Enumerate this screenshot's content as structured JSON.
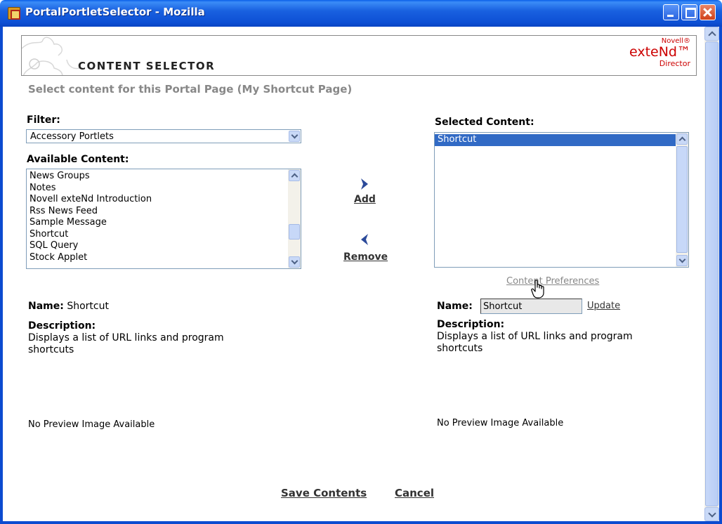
{
  "window": {
    "title": "PortalPortletSelector - Mozilla",
    "icon": "mozilla-app-icon",
    "controls": [
      "minimize",
      "maximize",
      "close"
    ]
  },
  "header": {
    "title": "CONTENT SELECTOR",
    "brand": {
      "top": "Novell®",
      "main": "exteNd™",
      "bottom": "Director",
      "color": "#cc0000"
    }
  },
  "subtitle": "Select content for this Portal Page (My Shortcut Page)",
  "filter": {
    "label": "Filter:",
    "selected": "Accessory Portlets"
  },
  "available": {
    "label": "Available Content:",
    "items": [
      "News Groups",
      "Notes",
      "Novell exteNd Introduction",
      "Rss News Feed",
      "Sample Message",
      "Shortcut",
      "SQL Query",
      "Stock Applet"
    ]
  },
  "selected": {
    "label": "Selected Content:",
    "items": [
      "Shortcut"
    ],
    "selected_index": 0
  },
  "actions": {
    "add": "Add",
    "remove": "Remove",
    "content_preferences": "Content Preferences",
    "update": "Update",
    "save": "Save Contents",
    "cancel": "Cancel"
  },
  "left_detail": {
    "name_label": "Name:",
    "name_value": "Shortcut",
    "description_label": "Description:",
    "description": "Displays a list of URL links and program shortcuts",
    "preview": "No Preview Image Available"
  },
  "right_detail": {
    "name_label": "Name:",
    "name_value": "Shortcut",
    "description_label": "Description:",
    "description": "Displays a list of URL links and program shortcuts",
    "preview": "No Preview Image Available"
  },
  "colors": {
    "titlebar": "#0a5fe8",
    "selection": "#316ac5",
    "subtitle": "#888888",
    "arrow": "#2b4a9a"
  }
}
